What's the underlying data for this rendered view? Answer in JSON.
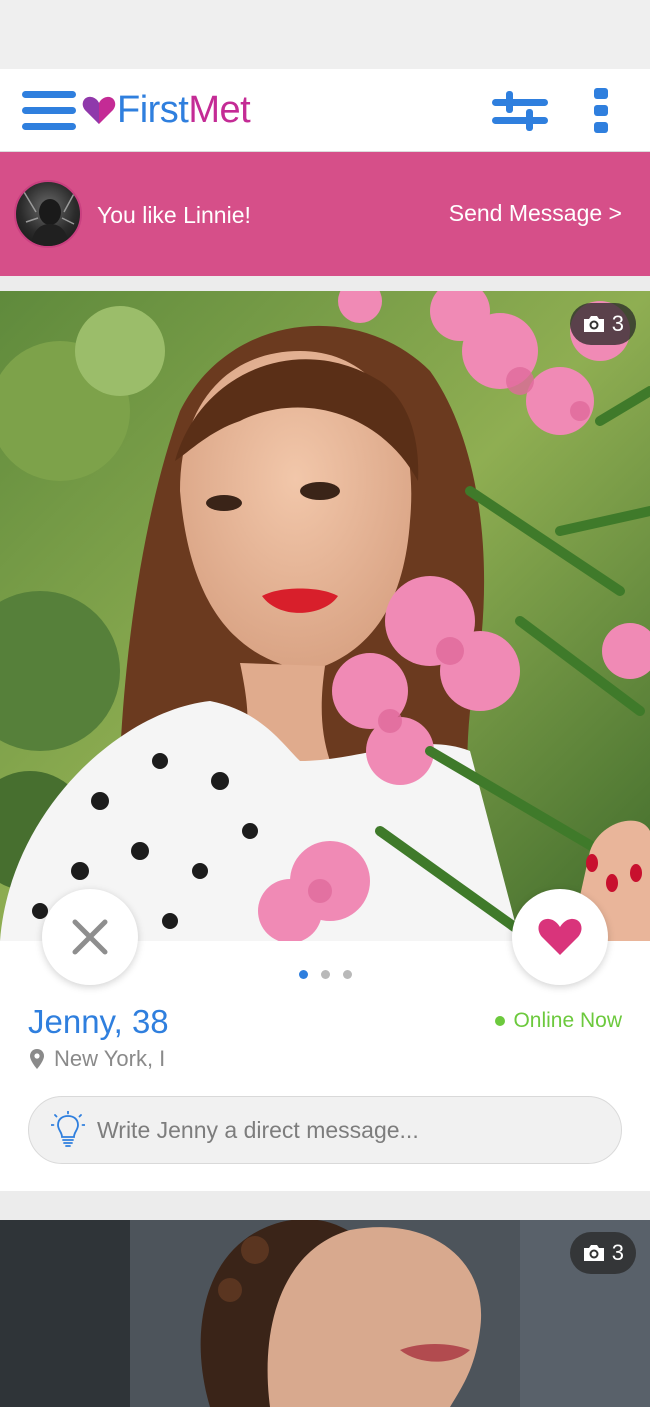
{
  "header": {
    "logo_first": "First",
    "logo_met": "Met",
    "menu_icon": "hamburger-menu-icon",
    "filter_icon": "sliders-icon",
    "more_icon": "more-vertical-icon"
  },
  "match_banner": {
    "text": "You like Linnie!",
    "action_label": "Send Message >"
  },
  "profile": {
    "photo_count": "3",
    "name_age": "Jenny, 38",
    "status": "Online Now",
    "location": "New York, I",
    "message_placeholder": "Write Jenny a direct message...",
    "photo_dots_total": 3,
    "photo_dots_active": 0
  },
  "next_profile": {
    "photo_count": "3"
  },
  "colors": {
    "brand_blue": "#2f7fde",
    "brand_magenta": "#c42b95",
    "banner_pink": "#d64f89",
    "like_heart": "#d9347b",
    "online_green": "#6cc93d"
  }
}
